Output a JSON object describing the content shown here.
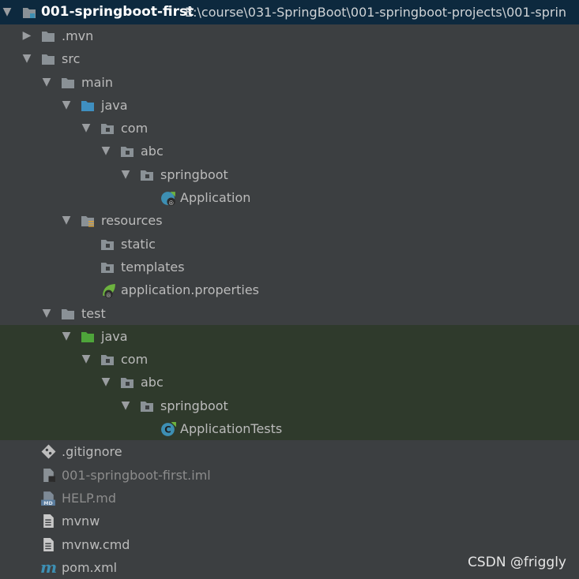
{
  "project": {
    "name": "001-springboot-first",
    "path": "E:\\course\\031-SpringBoot\\001-springboot-projects\\001-sprin"
  },
  "tree": {
    "mvn": ".mvn",
    "src": "src",
    "main": "main",
    "main_java": "java",
    "main_com": "com",
    "main_abc": "abc",
    "main_springboot": "springboot",
    "application": "Application",
    "resources": "resources",
    "static": "static",
    "templates": "templates",
    "application_properties": "application.properties",
    "test": "test",
    "test_java": "java",
    "test_com": "com",
    "test_abc": "abc",
    "test_springboot": "springboot",
    "application_tests": "ApplicationTests",
    "gitignore": ".gitignore",
    "iml": "001-springboot-first.iml",
    "help": "HELP.md",
    "mvnw": "mvnw",
    "mvnw_cmd": "mvnw.cmd",
    "pom": "pom.xml"
  },
  "watermark": "CSDN @friggly",
  "icons": {
    "folder": "folder-icon",
    "source_folder": "source-folder-icon",
    "test_folder": "test-folder-icon",
    "package": "package-icon",
    "resources": "resources-folder-icon",
    "spring_class": "spring-boot-class-icon",
    "spring_properties": "spring-properties-icon",
    "test_class": "test-class-icon",
    "git": "git-icon",
    "module": "module-file-icon",
    "markdown": "markdown-icon",
    "text": "text-file-icon",
    "maven": "maven-icon"
  },
  "colors": {
    "background": "#3c3f41",
    "selected_row": "#0d293e",
    "test_highlight": "#2f3a2c",
    "folder": "#8a9196",
    "source_folder": "#3f8fc0",
    "test_folder": "#4ea53a",
    "spring": "#6db33f"
  }
}
